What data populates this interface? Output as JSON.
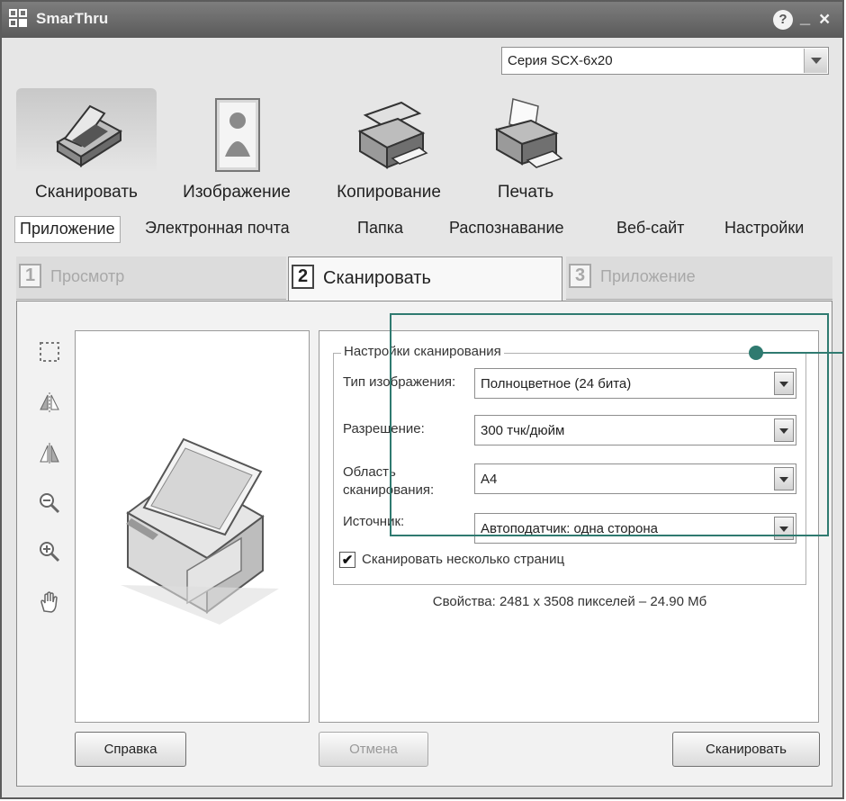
{
  "window": {
    "title": "SmarThru"
  },
  "titlebar": {
    "help_label": "?",
    "minimize_label": "_",
    "close_label": "×"
  },
  "device": {
    "selected": "Серия SCX-6x20"
  },
  "main_tabs": [
    {
      "label": "Сканировать",
      "icon": "scanner-icon",
      "active": true
    },
    {
      "label": "Изображение",
      "icon": "image-icon",
      "active": false
    },
    {
      "label": "Копирование",
      "icon": "copier-icon",
      "active": false
    },
    {
      "label": "Печать",
      "icon": "printer-icon",
      "active": false
    }
  ],
  "sub_tabs": [
    {
      "label": "Приложение",
      "active": true
    },
    {
      "label": "Электронная почта"
    },
    {
      "label": "Папка"
    },
    {
      "label": "Распознавание"
    },
    {
      "label": "Веб-сайт"
    },
    {
      "label": "Настройки"
    }
  ],
  "steps": [
    {
      "num": "1",
      "label": "Просмотр",
      "state": "inactive"
    },
    {
      "num": "2",
      "label": "Сканировать",
      "state": "active"
    },
    {
      "num": "3",
      "label": "Приложение",
      "state": "disabled"
    }
  ],
  "tools": [
    "select-area-icon",
    "flip-horizontal-icon",
    "flip-vertical-icon",
    "zoom-out-icon",
    "zoom-in-icon",
    "pan-hand-icon"
  ],
  "settings": {
    "group_title": "Настройки сканирования",
    "image_type": {
      "label": "Тип изображения:",
      "value": "Полноцветное (24 бита)"
    },
    "resolution": {
      "label": "Разрешение:",
      "value": "300 тчк/дюйм"
    },
    "scan_area": {
      "label_line1": "Область",
      "label_line2": "сканирования:",
      "value": "A4"
    },
    "source": {
      "label": "Источник:",
      "value": "Автоподатчик: одна сторона"
    },
    "multi_page": {
      "label": "Сканировать несколько страниц",
      "checked": true,
      "mark": "✔"
    }
  },
  "properties_text": "Свойства: 2481 x 3508 пикселей – 24.90 Мб",
  "buttons": {
    "help": "Справка",
    "cancel": "Отмена",
    "scan": "Сканировать"
  },
  "colors": {
    "callout": "#2f7a70",
    "titlebar": "#6b6b6b"
  }
}
